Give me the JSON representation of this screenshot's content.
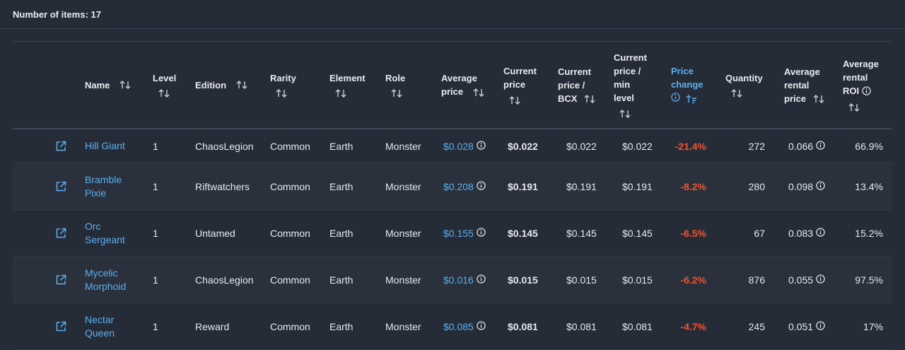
{
  "summary": {
    "label": "Number of items: 17"
  },
  "columns": [
    {
      "key": "name",
      "line1": "Name",
      "line2": "",
      "line3": "",
      "line4": ""
    },
    {
      "key": "level",
      "line1": "Level",
      "line2": "",
      "line3": "",
      "line4": ""
    },
    {
      "key": "edition",
      "line1": "Edition",
      "line2": "",
      "line3": "",
      "line4": ""
    },
    {
      "key": "rarity",
      "line1": "Rarity",
      "line2": "",
      "line3": "",
      "line4": ""
    },
    {
      "key": "element",
      "line1": "Element",
      "line2": "",
      "line3": "",
      "line4": ""
    },
    {
      "key": "role",
      "line1": "Role",
      "line2": "",
      "line3": "",
      "line4": ""
    },
    {
      "key": "avg_price",
      "line1": "Average",
      "line2": "price",
      "line3": "",
      "line4": ""
    },
    {
      "key": "cur_price",
      "line1": "Current",
      "line2": "price",
      "line3": "",
      "line4": ""
    },
    {
      "key": "cur_bcx",
      "line1": "Current",
      "line2": "price /",
      "line3": "BCX",
      "line4": ""
    },
    {
      "key": "cur_min",
      "line1": "Current",
      "line2": "price /",
      "line3": "min",
      "line4": "level"
    },
    {
      "key": "price_change",
      "line1": "Price",
      "line2": "change",
      "line3": "",
      "line4": ""
    },
    {
      "key": "quantity",
      "line1": "Quantity",
      "line2": "",
      "line3": "",
      "line4": ""
    },
    {
      "key": "avg_rental",
      "line1": "Average",
      "line2": "rental",
      "line3": "price",
      "line4": ""
    },
    {
      "key": "avg_roi",
      "line1": "Average",
      "line2": "rental",
      "line3": "ROI",
      "line4": ""
    }
  ],
  "rows": [
    {
      "name1": "Hill Giant",
      "name2": "",
      "level": "1",
      "edition": "ChaosLegion",
      "rarity": "Common",
      "element": "Earth",
      "role": "Monster",
      "avg_price": "$0.028",
      "cur_price": "$0.022",
      "cur_bcx": "$0.022",
      "cur_min": "$0.022",
      "price_change": "-21.4%",
      "quantity": "272",
      "avg_rental": "0.066",
      "avg_roi": "66.9%"
    },
    {
      "name1": "Bramble",
      "name2": "Pixie",
      "level": "1",
      "edition": "Riftwatchers",
      "rarity": "Common",
      "element": "Earth",
      "role": "Monster",
      "avg_price": "$0.208",
      "cur_price": "$0.191",
      "cur_bcx": "$0.191",
      "cur_min": "$0.191",
      "price_change": "-8.2%",
      "quantity": "280",
      "avg_rental": "0.098",
      "avg_roi": "13.4%"
    },
    {
      "name1": "Orc",
      "name2": "Sergeant",
      "level": "1",
      "edition": "Untamed",
      "rarity": "Common",
      "element": "Earth",
      "role": "Monster",
      "avg_price": "$0.155",
      "cur_price": "$0.145",
      "cur_bcx": "$0.145",
      "cur_min": "$0.145",
      "price_change": "-6.5%",
      "quantity": "67",
      "avg_rental": "0.083",
      "avg_roi": "15.2%"
    },
    {
      "name1": "Mycelic",
      "name2": "Morphoid",
      "level": "1",
      "edition": "ChaosLegion",
      "rarity": "Common",
      "element": "Earth",
      "role": "Monster",
      "avg_price": "$0.016",
      "cur_price": "$0.015",
      "cur_bcx": "$0.015",
      "cur_min": "$0.015",
      "price_change": "-6.2%",
      "quantity": "876",
      "avg_rental": "0.055",
      "avg_roi": "97.5%"
    },
    {
      "name1": "Nectar",
      "name2": "Queen",
      "level": "1",
      "edition": "Reward",
      "rarity": "Common",
      "element": "Earth",
      "role": "Monster",
      "avg_price": "$0.085",
      "cur_price": "$0.081",
      "cur_bcx": "$0.081",
      "cur_min": "$0.081",
      "price_change": "-4.7%",
      "quantity": "245",
      "avg_rental": "0.051",
      "avg_roi": "17%"
    }
  ],
  "colors": {
    "accent": "#5ab0f0",
    "negative": "#f0532f",
    "background": "#262c37"
  },
  "icons": {
    "external": "external-link-icon",
    "sort": "sort-arrows-icon",
    "info": "info-icon"
  }
}
